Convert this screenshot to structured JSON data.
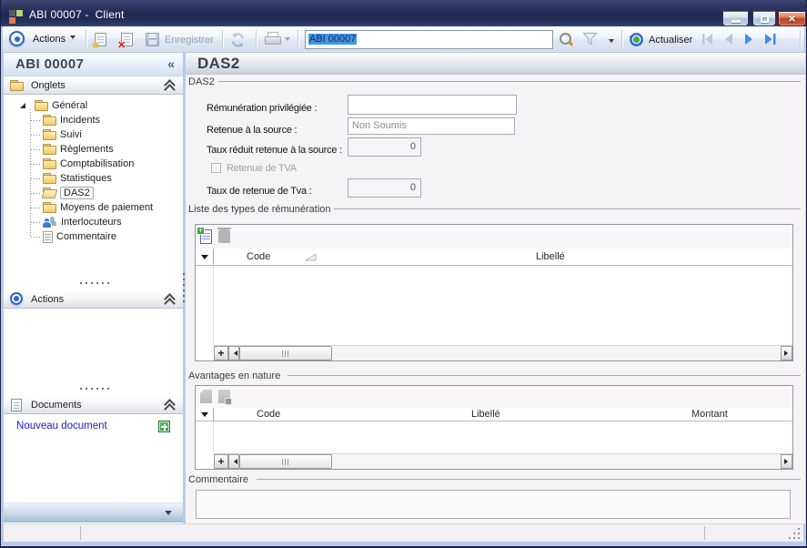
{
  "window": {
    "title": "ABI 00007 -  Client"
  },
  "toolbar": {
    "actions_label": "Actions",
    "save_label": "Enregistrer",
    "record_input_value": "ABI 00007",
    "refresh_label": "Actualiser"
  },
  "sidebar": {
    "record_title": "ABI 00007",
    "collapse_glyph": "«",
    "onglets_title": "Onglets",
    "actions_title": "Actions",
    "documents_title": "Documents",
    "new_document_label": "Nouveau document",
    "tree_root": "Général",
    "tree_items": [
      {
        "label": "Incidents",
        "icon": "folder"
      },
      {
        "label": "Suivi",
        "icon": "folder"
      },
      {
        "label": "Règlements",
        "icon": "folder"
      },
      {
        "label": "Comptabilisation",
        "icon": "folder"
      },
      {
        "label": "Statistiques",
        "icon": "folder"
      },
      {
        "label": "DAS2",
        "icon": "folder-open",
        "selected": true
      },
      {
        "label": "Moyens de paiement",
        "icon": "folder"
      },
      {
        "label": "Interlocuteurs",
        "icon": "people"
      },
      {
        "label": "Commentaire",
        "icon": "note"
      }
    ]
  },
  "main": {
    "page_title": "DAS2",
    "group_das2": "DAS2",
    "labels": {
      "remuneration": "Rémunération privilégiée :",
      "retenue_source": "Retenue à la source :",
      "taux_reduit": "Taux réduit retenue à la source :",
      "retenue_tva": "Retenue de TVA",
      "taux_tva": "Taux de retenue de Tva :"
    },
    "values": {
      "remuneration": "",
      "retenue_source": "Non Soumis",
      "taux_reduit": "0",
      "retenue_tva_checked": false,
      "taux_tva": "0"
    },
    "group_rem_list": "Liste des types de rémunération",
    "rem_grid_columns": [
      "Code",
      "Libellé"
    ],
    "group_avantages": "Avantages en nature",
    "av_grid_columns": [
      "Code",
      "Libellé",
      "Montant"
    ],
    "group_commentaire": "Commentaire",
    "comment_value": ""
  }
}
